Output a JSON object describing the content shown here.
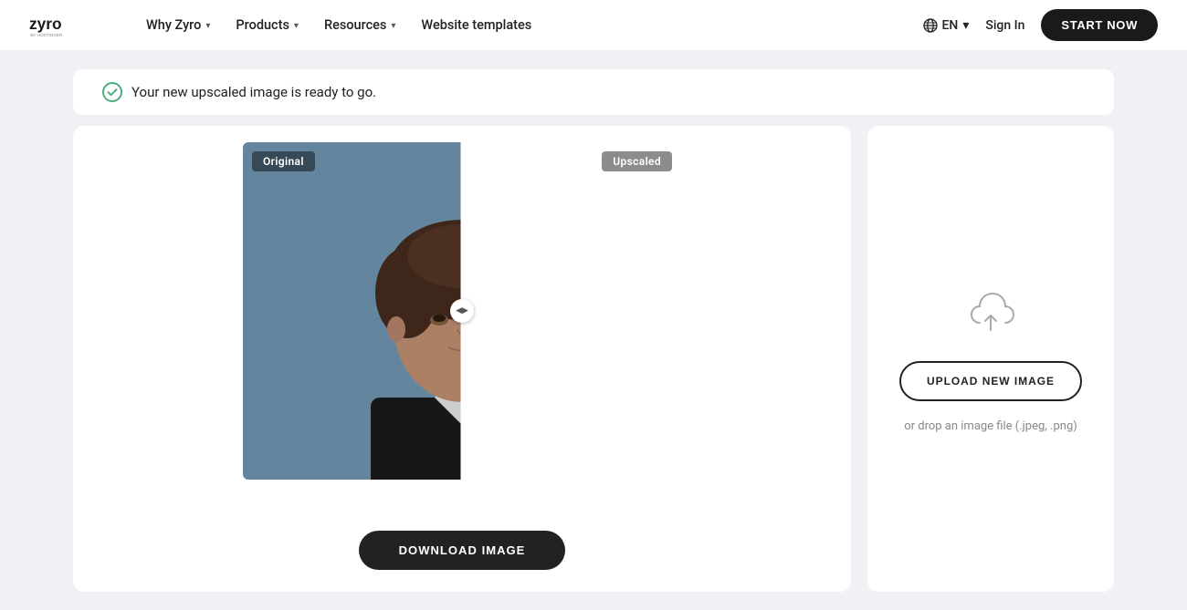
{
  "navbar": {
    "logo_alt": "Zyro by Hostinger",
    "nav_items": [
      {
        "label": "Why Zyro",
        "has_dropdown": true
      },
      {
        "label": "Products",
        "has_dropdown": true
      },
      {
        "label": "Resources",
        "has_dropdown": true
      },
      {
        "label": "Website templates",
        "has_dropdown": false
      }
    ],
    "lang": "EN",
    "sign_in": "Sign In",
    "start_btn": "START NOW"
  },
  "success_banner": {
    "message": "Your new upscaled image is ready to go."
  },
  "compare": {
    "label_original": "Original",
    "label_upscaled": "Upscaled"
  },
  "download_btn": "DOWNLOAD IMAGE",
  "upload_panel": {
    "upload_btn": "UPLOAD NEW IMAGE",
    "drop_hint": "or drop an image file (.jpeg, .png)"
  }
}
